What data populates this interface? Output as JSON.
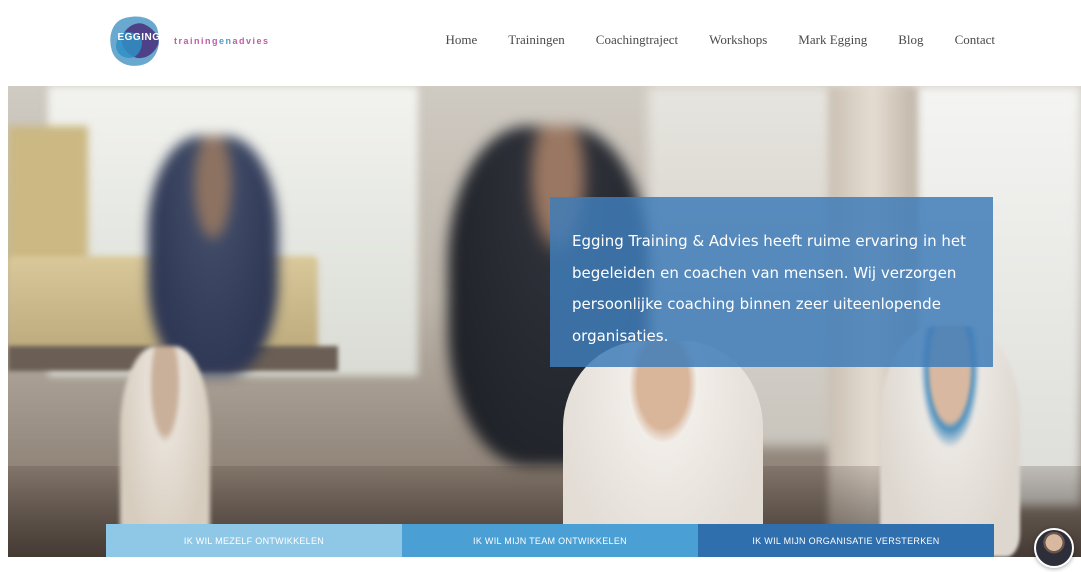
{
  "header": {
    "logo": {
      "wordmark": "EGGING",
      "tagline_part1": "training",
      "tagline_part2": "en",
      "tagline_part3": "advies"
    },
    "nav": [
      {
        "label": "Home"
      },
      {
        "label": "Trainingen"
      },
      {
        "label": "Coachingtraject"
      },
      {
        "label": "Workshops"
      },
      {
        "label": "Mark Egging"
      },
      {
        "label": "Blog"
      },
      {
        "label": "Contact"
      }
    ]
  },
  "hero": {
    "intro_text": "Egging Training & Advies heeft ruime ervaring in het begeleiden en coachen van mensen. Wij verzorgen persoonlijke coaching binnen zeer uiteenlopende organisaties."
  },
  "ctas": [
    {
      "label": "IK WIL MEZELF ONTWIKKELEN"
    },
    {
      "label": "IK WIL MIJN TEAM ONTWIKKELEN"
    },
    {
      "label": "IK WIL MIJN ORGANISATIE VERSTERKEN"
    }
  ],
  "colors": {
    "accent_blue": "#3f7db9",
    "cta_light": "#8fc8e6",
    "cta_mid": "#4a9fd4",
    "cta_dark": "#2f6fae",
    "logo_magenta": "#c05aa6"
  },
  "icons": {
    "logo": "egging-logo-icon",
    "avatar": "coach-avatar-icon"
  }
}
